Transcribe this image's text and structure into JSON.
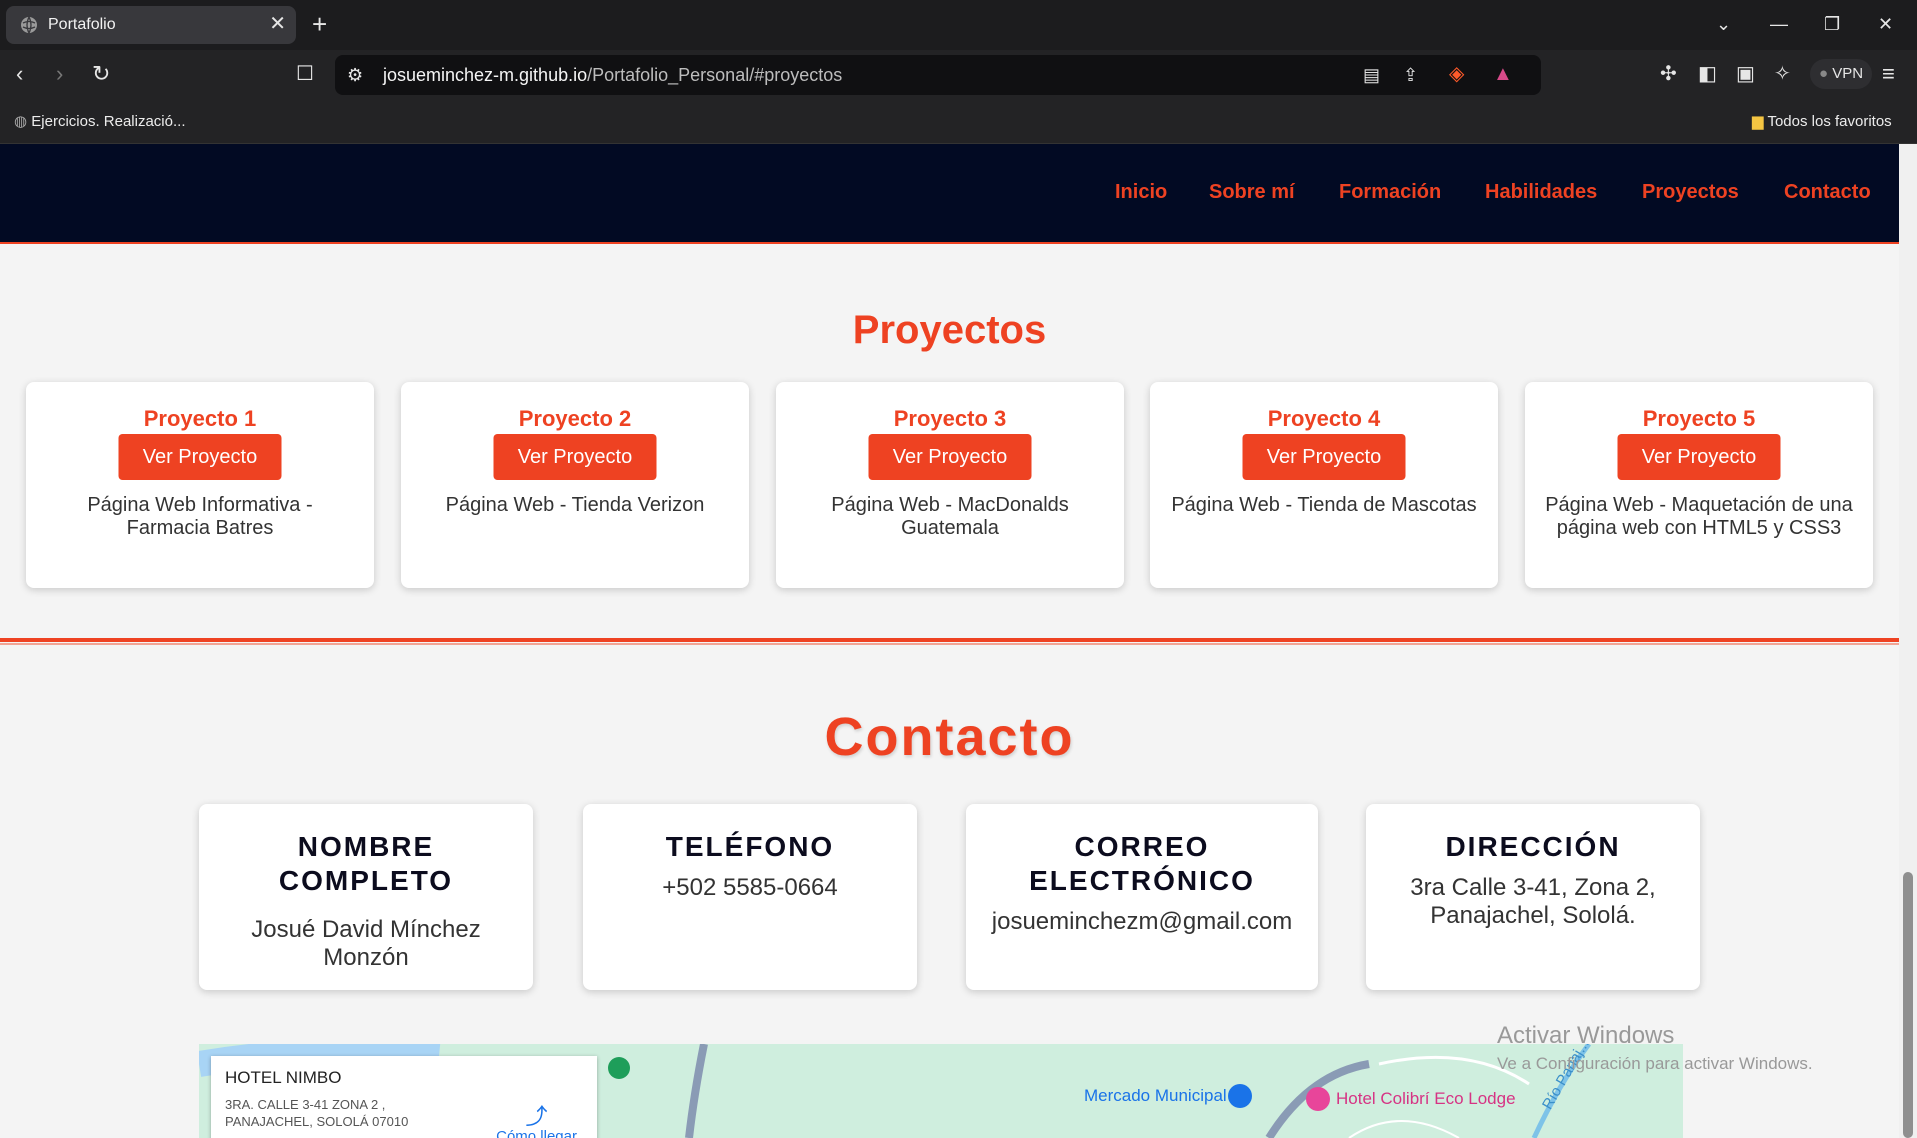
{
  "browser": {
    "tab_title": "Portafolio",
    "url_host": "josueminchez-m.github.io",
    "url_path": "/Portafolio_Personal/#proyectos",
    "vpn_label": "VPN",
    "bookmark_left": "Ejercicios. Realizació...",
    "bookmark_right": "Todos los favoritos"
  },
  "nav": {
    "items": [
      "Inicio",
      "Sobre mí",
      "Formación",
      "Habilidades",
      "Proyectos",
      "Contacto"
    ]
  },
  "projects": {
    "title": "Proyectos",
    "button_label": "Ver Proyecto",
    "items": [
      {
        "title": "Proyecto 1",
        "desc": "Página Web Informativa - Farmacia Batres"
      },
      {
        "title": "Proyecto 2",
        "desc": "Página Web - Tienda Verizon"
      },
      {
        "title": "Proyecto 3",
        "desc": "Página Web - MacDonalds Guatemala"
      },
      {
        "title": "Proyecto 4",
        "desc": "Página Web - Tienda de Mascotas"
      },
      {
        "title": "Proyecto 5",
        "desc": "Página Web - Maquetación de una página web con HTML5 y CSS3"
      }
    ]
  },
  "contact": {
    "title": "Contacto",
    "cards": [
      {
        "heading": "NOMBRE COMPLETO",
        "value": "Josué David Mínchez Monzón"
      },
      {
        "heading": "TELÉFONO",
        "value": "+502 5585-0664"
      },
      {
        "heading": "CORREO ELECTRÓNICO",
        "value": "josueminchezm@gmail.com"
      },
      {
        "heading": "DIRECCIÓN",
        "value": "3ra Calle 3-41, Zona 2, Panajachel, Sololá."
      }
    ]
  },
  "map": {
    "place_title": "HOTEL NIMBO",
    "place_address": "3RA. CALLE 3-41 ZONA 2 , PANAJACHEL, SOLOLÁ 07010",
    "directions_label": "Cómo llegar",
    "label_market": "Mercado Municipal",
    "label_hotel": "Hotel Colibrí Eco Lodge",
    "label_river": "Río Panaj..."
  },
  "watermark": {
    "title": "Activar Windows",
    "subtitle": "Ve a Configuración para activar Windows."
  },
  "colors": {
    "accent": "#ee4222",
    "nav_bg": "#020a23",
    "page_bg": "#f4f4f4"
  }
}
